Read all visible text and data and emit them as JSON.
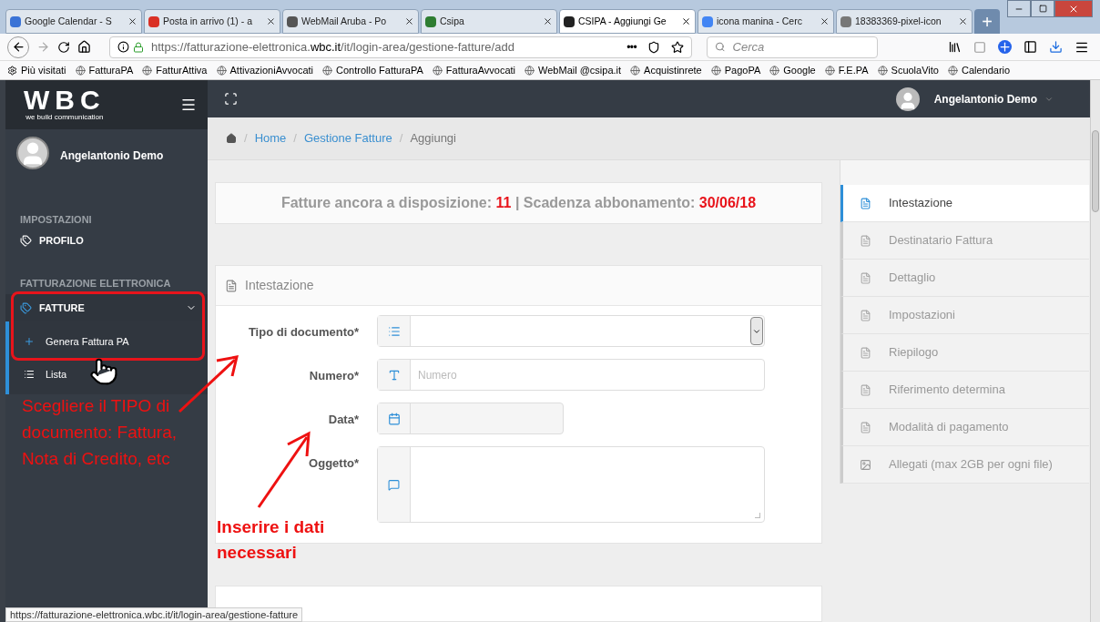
{
  "browser": {
    "tabs": [
      {
        "label": "Google Calendar - S",
        "selected": false
      },
      {
        "label": "Posta in arrivo (1) - a",
        "selected": false
      },
      {
        "label": "WebMail Aruba - Po",
        "selected": false
      },
      {
        "label": "Csipa",
        "selected": false
      },
      {
        "label": "CSIPA - Aggiungi Ge",
        "selected": true
      },
      {
        "label": "icona manina - Cerc",
        "selected": false
      },
      {
        "label": "18383369-pixel-icon",
        "selected": false
      }
    ],
    "new_tab": "+",
    "url_host_prefix": "https://fatturazione-elettronica.",
    "url_host": "wbc.it",
    "url_path": "/it/login-area/gestione-fatture/add",
    "page_actions": "•••",
    "search_placeholder": "Cerca",
    "bookmarks": [
      "Più visitati",
      "FatturaPA",
      "FatturAttiva",
      "AttivazioniAvvocati",
      "Controllo FatturaPA",
      "FatturaAvvocati",
      "WebMail @csipa.it",
      "Acquistinrete",
      "PagoPA",
      "Google",
      "F.E.PA",
      "ScuolaVito",
      "Calendario"
    ]
  },
  "app": {
    "logo": "WBC",
    "logo_tagline": "we build communication",
    "header_user": "Angelantonio Demo",
    "sidebar": {
      "user": "Angelantonio Demo",
      "sections": [
        {
          "title": "IMPOSTAZIONI",
          "items": [
            {
              "label": "PROFILO",
              "expanded": false
            }
          ]
        },
        {
          "title": "FATTURAZIONE ELETTRONICA",
          "items": [
            {
              "label": "FATTURE",
              "expanded": true,
              "children": [
                {
                  "label": "Genera Fattura PA",
                  "kind": "add"
                },
                {
                  "label": "Lista",
                  "kind": "list"
                }
              ]
            }
          ]
        }
      ]
    },
    "breadcrumb_separator": "/",
    "breadcrumb": [
      {
        "label": "Home",
        "kind": "link"
      },
      {
        "label": "Gestione Fatture",
        "kind": "link"
      },
      {
        "label": "Aggiungi",
        "kind": "current"
      }
    ],
    "info": {
      "available_label": "Fatture ancora a disposizione:",
      "available": "11",
      "separator": "|",
      "expiry_label": "Scadenza abbonamento:",
      "expiry": "30/06/18"
    },
    "form": {
      "title": "Intestazione",
      "fields": [
        {
          "label": "Tipo di documento*",
          "kind": "select"
        },
        {
          "label": "Numero*",
          "kind": "text",
          "placeholder": "Numero"
        },
        {
          "label": "Data*",
          "kind": "date"
        },
        {
          "label": "Oggetto*",
          "kind": "textarea"
        }
      ]
    },
    "steps": [
      {
        "label": "Intestazione",
        "selected": true,
        "kind": "document"
      },
      {
        "label": "Destinatario Fattura",
        "selected": false,
        "kind": "document"
      },
      {
        "label": "Dettaglio",
        "selected": false,
        "kind": "document"
      },
      {
        "label": "Impostazioni",
        "selected": false,
        "kind": "document"
      },
      {
        "label": "Riepilogo",
        "selected": false,
        "kind": "document"
      },
      {
        "label": "Riferimento determina",
        "selected": false,
        "kind": "document"
      },
      {
        "label": "Modalità di pagamento",
        "selected": false,
        "kind": "document"
      },
      {
        "label": "Allegati (max 2GB per ogni file)",
        "selected": false,
        "kind": "image"
      }
    ]
  },
  "annotations": {
    "note_1": "Scegliere il TIPO di documento: Fattura, Nota di Credito, etc",
    "note_2": "Inserire i dati necessari"
  },
  "status_bar": "https://fatturazione-elettronica.wbc.it/it/login-area/gestione-fatture"
}
